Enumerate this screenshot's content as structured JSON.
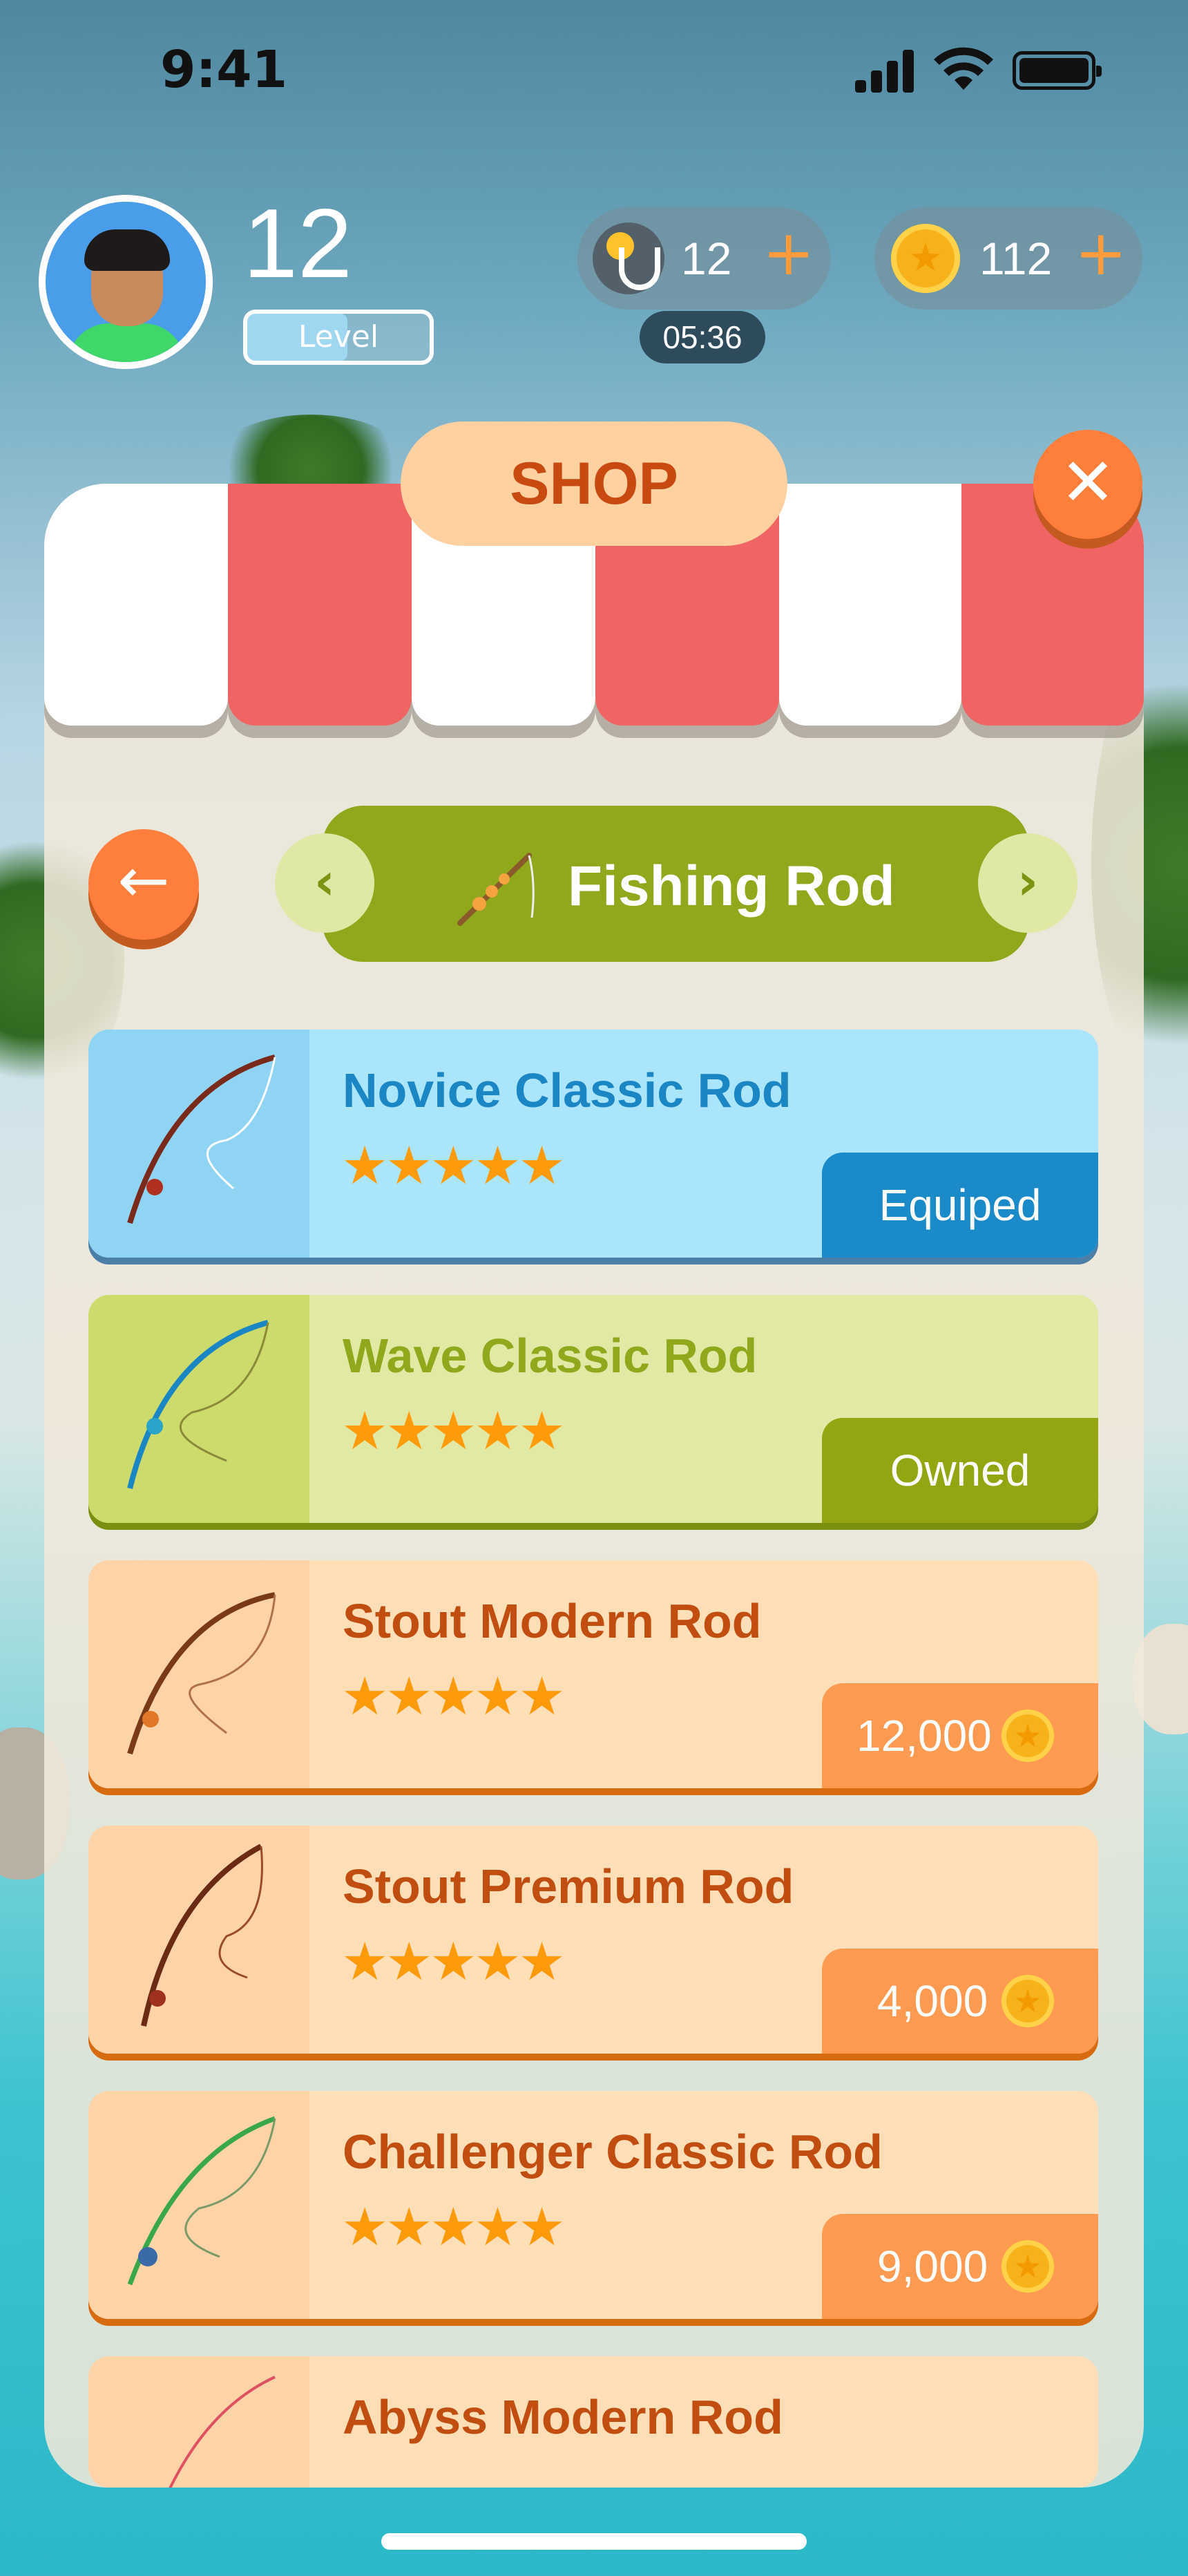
{
  "status_bar": {
    "time": "9:41"
  },
  "player": {
    "level": "12",
    "level_label": "Level",
    "level_progress": 0.55
  },
  "currencies": {
    "hooks": {
      "value": "12",
      "icon": "hook-icon",
      "timer": "05:36"
    },
    "coins": {
      "value": "112",
      "icon": "coin-icon"
    }
  },
  "shop": {
    "title": "SHOP",
    "category": "Fishing Rod",
    "items": [
      {
        "name": "Novice Classic Rod",
        "stars": "★★★★★",
        "tag": "Equiped",
        "theme": "blue"
      },
      {
        "name": "Wave Classic Rod",
        "stars": "★★★★★",
        "tag": "Owned",
        "theme": "green"
      },
      {
        "name": "Stout Modern Rod",
        "stars": "★★★★★",
        "price": "12,000",
        "theme": "orange"
      },
      {
        "name": "Stout Premium Rod",
        "stars": "★★★★★",
        "price": "4,000",
        "theme": "orange"
      },
      {
        "name": "Challenger Classic Rod",
        "stars": "★★★★★",
        "price": "9,000",
        "theme": "orange"
      },
      {
        "name": "Abyss Modern Rod",
        "stars": "",
        "theme": "orange"
      }
    ]
  },
  "colors": {
    "accent_orange": "#ff7e3b",
    "category_green": "#8fa81c",
    "equipped_blue": "#1b8ac8",
    "owned_green": "#93a612",
    "awning_red": "#f06464"
  }
}
